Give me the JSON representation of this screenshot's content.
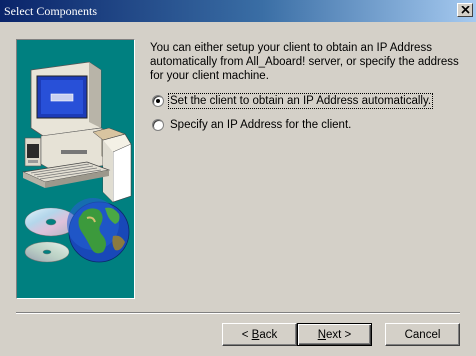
{
  "window": {
    "title": "Select Components"
  },
  "description": "You can either setup your client to obtain an IP Address automatically from All_Aboard! server, or specify the address for your client machine.",
  "options": [
    {
      "label": "Set the client to obtain an IP Address automatically.",
      "selected": true
    },
    {
      "label": "Specify an IP Address for the client.",
      "selected": false
    }
  ],
  "buttons": {
    "back_prefix": "< ",
    "back_mnemonic": "B",
    "back_rest": "ack",
    "next_mnemonic": "N",
    "next_rest": "ext >",
    "cancel": "Cancel"
  },
  "icons": {
    "close": "close-icon",
    "illustration": "computer-globe-illustration"
  },
  "colors": {
    "panel_background": "#008080",
    "titlebar_start": "#0a246a",
    "titlebar_end": "#a6caf0",
    "dialog_face": "#d4d0c8"
  }
}
